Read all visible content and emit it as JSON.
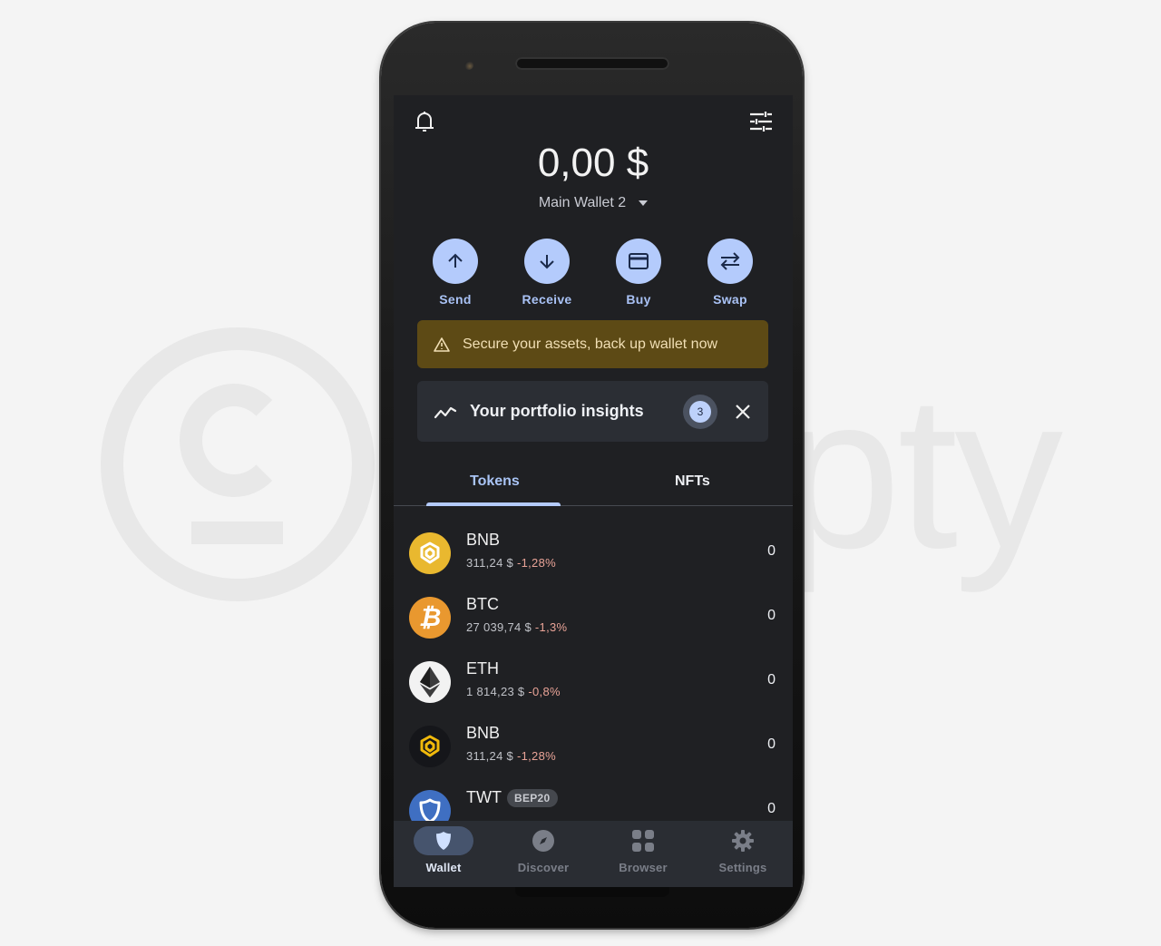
{
  "watermark": {
    "text": "pty"
  },
  "header": {
    "notifications_icon": "bell-icon",
    "filters_icon": "sliders-icon",
    "balance": "0,00 $",
    "wallet_name": "Main Wallet 2"
  },
  "actions": [
    {
      "label": "Send",
      "icon": "arrow-up-icon"
    },
    {
      "label": "Receive",
      "icon": "arrow-down-icon"
    },
    {
      "label": "Buy",
      "icon": "credit-card-icon"
    },
    {
      "label": "Swap",
      "icon": "swap-icon"
    }
  ],
  "backup_banner": {
    "icon": "warning-icon",
    "text": "Secure your assets, back up wallet now"
  },
  "insights": {
    "icon": "trend-line-icon",
    "title": "Your portfolio insights",
    "count": "3"
  },
  "tabs": [
    {
      "label": "Tokens",
      "active": true
    },
    {
      "label": "NFTs",
      "active": false
    }
  ],
  "tokens": [
    {
      "symbol": "BNB",
      "price": "311,24 $",
      "change": "-1,28%",
      "balance": "0"
    },
    {
      "symbol": "BTC",
      "price": "27 039,74 $",
      "change": "-1,3%",
      "balance": "0"
    },
    {
      "symbol": "ETH",
      "price": "1 814,23 $",
      "change": "-0,8%",
      "balance": "0"
    },
    {
      "symbol": "BNB",
      "price": "311,24 $",
      "change": "-1,28%",
      "balance": "0"
    },
    {
      "symbol": "TWT",
      "chip": "BEP20",
      "balance": "0"
    }
  ],
  "bottom_nav": [
    {
      "label": "Wallet",
      "active": true
    },
    {
      "label": "Discover",
      "active": false
    },
    {
      "label": "Browser",
      "active": false
    },
    {
      "label": "Settings",
      "active": false
    }
  ],
  "colors": {
    "accent": "#b4cbfc",
    "screen_bg": "#1f2023",
    "banner_bg": "#5d4a15",
    "negative_change": "#e9a397"
  }
}
